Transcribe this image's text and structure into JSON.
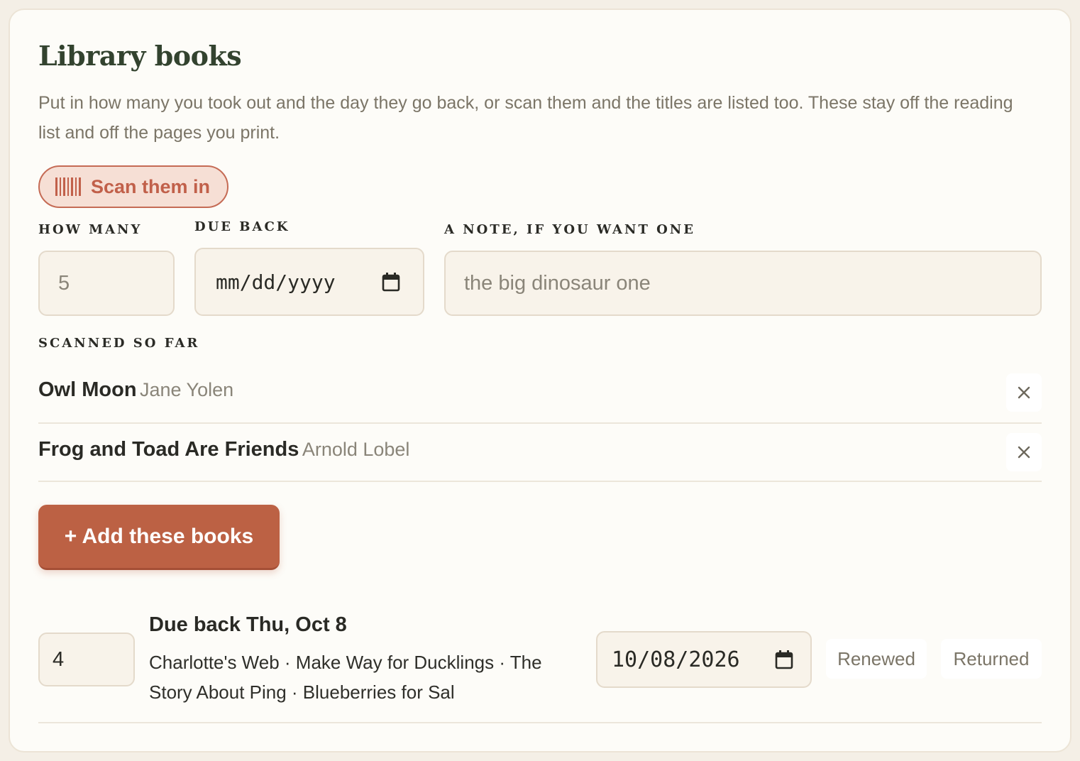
{
  "header": {
    "title": "Library books",
    "subtitle": "Put in how many you took out and the day they go back, or scan them and the titles are listed too. These stay off the reading list and off the pages you print."
  },
  "scan_button": {
    "label": "Scan them in",
    "icon": "barcode-icon"
  },
  "form": {
    "how_many_label": "HOW MANY",
    "how_many_value": "5",
    "due_back_label": "DUE BACK",
    "due_back_placeholder": "mm/dd/yyyy",
    "note_label": "A NOTE, IF YOU WANT ONE",
    "note_placeholder": "the big dinosaur one"
  },
  "scanned": {
    "label": "SCANNED SO FAR",
    "items": [
      {
        "title": "Owl Moon",
        "author": "Jane Yolen"
      },
      {
        "title": "Frog and Toad Are Friends",
        "author": "Arnold Lobel"
      }
    ]
  },
  "add_button": {
    "label": "+ Add these books"
  },
  "loans": [
    {
      "count": "4",
      "title": "Due back Thu, Oct 8",
      "books": "Charlotte's Web · Make Way for Ducklings · The Story About Ping · Blueberries for Sal",
      "date": "10/08/2026",
      "renewed_label": "Renewed",
      "returned_label": "Returned"
    }
  ],
  "colors": {
    "accent": "#bc6144",
    "heading": "#33432f",
    "card_bg": "#fdfcf8"
  }
}
